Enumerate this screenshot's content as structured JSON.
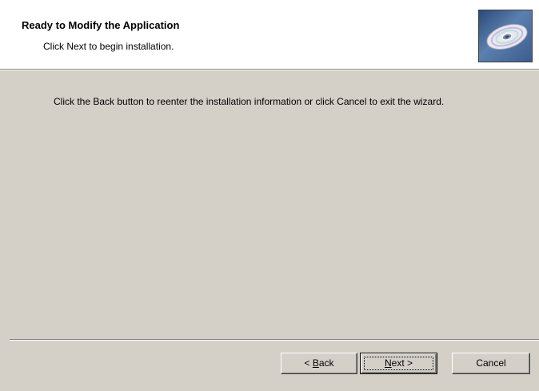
{
  "banner": {
    "title": "Ready to Modify the Application",
    "subtitle": "Click Next to begin installation.",
    "icon": "installation-cd-icon"
  },
  "body": {
    "instruction": "Click the Back button to reenter the installation information or click Cancel to exit the wizard."
  },
  "buttons": {
    "back": {
      "prefix": "< ",
      "mnemonic": "B",
      "rest": "ack"
    },
    "next": {
      "mnemonic": "N",
      "rest": "ext >"
    },
    "cancel": {
      "label": "Cancel"
    }
  },
  "colors": {
    "dialog_bg": "#d4d0c8",
    "banner_bg": "#ffffff",
    "icon_bg": "#3c5d8e"
  }
}
